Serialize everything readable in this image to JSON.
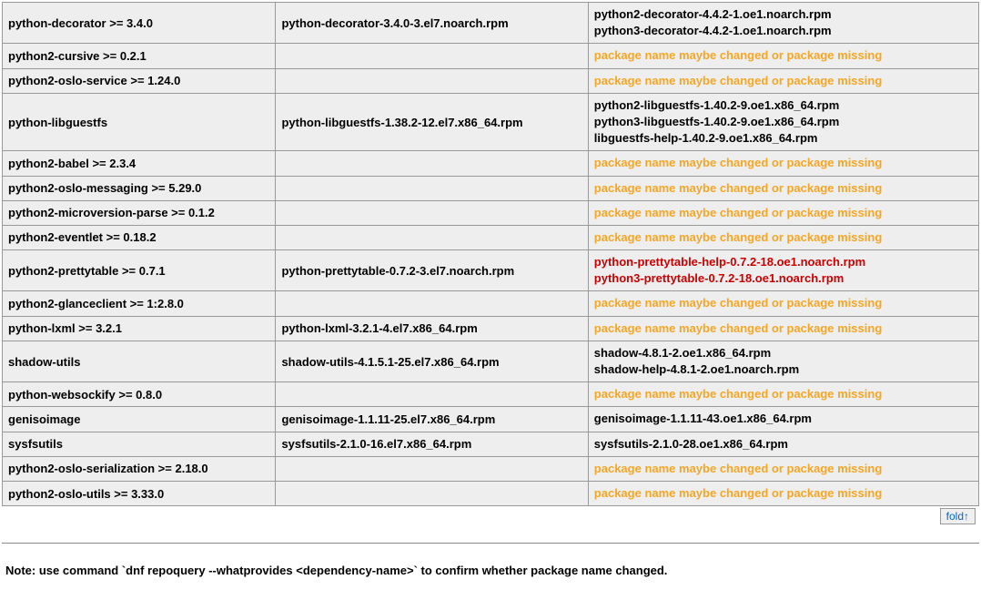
{
  "warn_text": "package name maybe changed or package missing",
  "rows": [
    {
      "c1": "python-decorator >= 3.4.0",
      "c2": "python-decorator-3.4.0-3.el7.noarch.rpm",
      "c3": [
        "python2-decorator-4.4.2-1.oe1.noarch.rpm",
        "python3-decorator-4.4.2-1.oe1.noarch.rpm"
      ],
      "style": "normal"
    },
    {
      "c1": "python2-cursive >= 0.2.1",
      "c2": "",
      "c3": "warn"
    },
    {
      "c1": "python2-oslo-service >= 1.24.0",
      "c2": "",
      "c3": "warn"
    },
    {
      "c1": "python-libguestfs",
      "c2": "python-libguestfs-1.38.2-12.el7.x86_64.rpm",
      "c3": [
        "python2-libguestfs-1.40.2-9.oe1.x86_64.rpm",
        "python3-libguestfs-1.40.2-9.oe1.x86_64.rpm",
        "libguestfs-help-1.40.2-9.oe1.x86_64.rpm"
      ],
      "style": "normal"
    },
    {
      "c1": "python2-babel >= 2.3.4",
      "c2": "",
      "c3": "warn"
    },
    {
      "c1": "python2-oslo-messaging >= 5.29.0",
      "c2": "",
      "c3": "warn"
    },
    {
      "c1": "python2-microversion-parse >= 0.1.2",
      "c2": "",
      "c3": "warn"
    },
    {
      "c1": "python2-eventlet >= 0.18.2",
      "c2": "",
      "c3": "warn"
    },
    {
      "c1": "python2-prettytable >= 0.7.1",
      "c2": "python-prettytable-0.7.2-3.el7.noarch.rpm",
      "c3": [
        "python-prettytable-help-0.7.2-18.oe1.noarch.rpm",
        "python3-prettytable-0.7.2-18.oe1.noarch.rpm"
      ],
      "style": "red"
    },
    {
      "c1": "python2-glanceclient >= 1:2.8.0",
      "c2": "",
      "c3": "warn"
    },
    {
      "c1": "python-lxml >= 3.2.1",
      "c2": "python-lxml-3.2.1-4.el7.x86_64.rpm",
      "c3": "warn"
    },
    {
      "c1": "shadow-utils",
      "c2": "shadow-utils-4.1.5.1-25.el7.x86_64.rpm",
      "c3": [
        "shadow-4.8.1-2.oe1.x86_64.rpm",
        "shadow-help-4.8.1-2.oe1.noarch.rpm"
      ],
      "style": "normal"
    },
    {
      "c1": "python-websockify >= 0.8.0",
      "c2": "",
      "c3": "warn"
    },
    {
      "c1": "genisoimage",
      "c2": "genisoimage-1.1.11-25.el7.x86_64.rpm",
      "c3": [
        "genisoimage-1.1.11-43.oe1.x86_64.rpm"
      ],
      "style": "normal"
    },
    {
      "c1": "sysfsutils",
      "c2": "sysfsutils-2.1.0-16.el7.x86_64.rpm",
      "c3": [
        "sysfsutils-2.1.0-28.oe1.x86_64.rpm"
      ],
      "style": "normal"
    },
    {
      "c1": "python2-oslo-serialization >= 2.18.0",
      "c2": "",
      "c3": "warn"
    },
    {
      "c1": "python2-oslo-utils >= 3.33.0",
      "c2": "",
      "c3": "warn"
    }
  ],
  "fold_label": "fold↑",
  "note": "Note: use command `dnf repoquery --whatprovides <dependency-name>` to confirm whether package name changed."
}
